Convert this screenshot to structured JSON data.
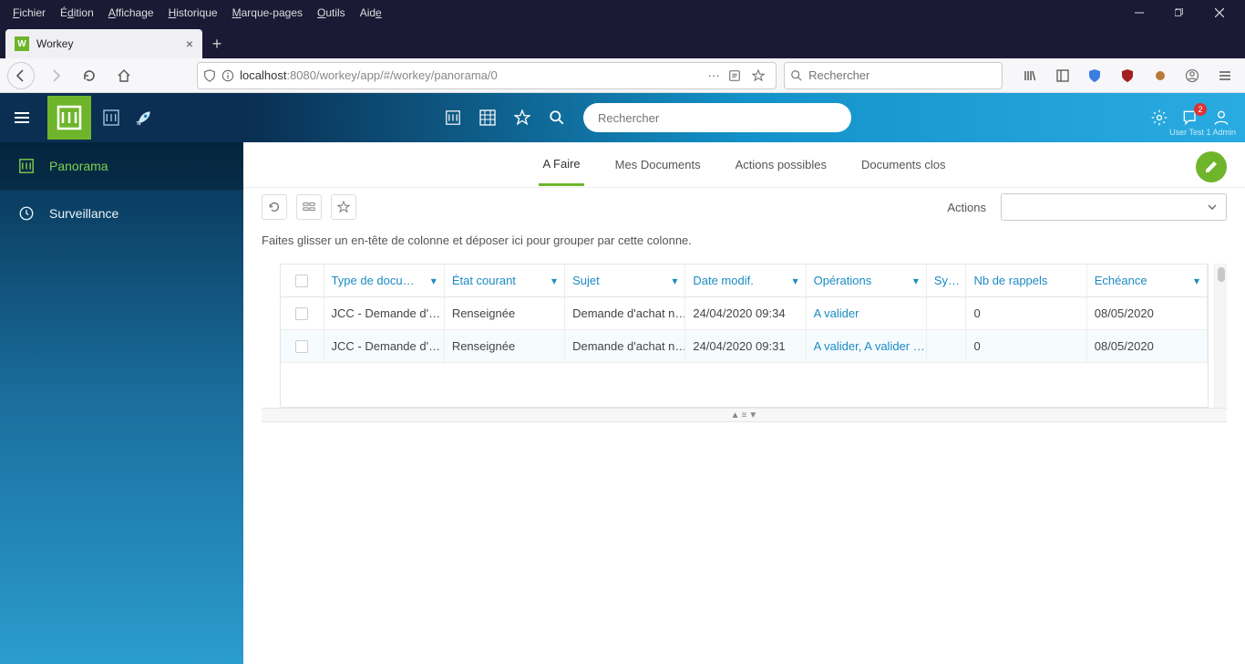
{
  "browser": {
    "menu": [
      "Fichier",
      "Édition",
      "Affichage",
      "Historique",
      "Marque-pages",
      "Outils",
      "Aide"
    ],
    "tab_title": "Workey",
    "url_host": "localhost",
    "url_port": ":8080",
    "url_path": "/workey/app/#/workey/panorama/0",
    "search_placeholder": "Rechercher"
  },
  "app": {
    "search_placeholder": "Rechercher",
    "user_label": "User Test 1 Admin",
    "notification_count": "2"
  },
  "sidebar": {
    "items": [
      {
        "label": "Panorama",
        "active": true
      },
      {
        "label": "Surveillance",
        "active": false
      }
    ]
  },
  "tabs": {
    "items": [
      {
        "label": "A Faire",
        "active": true
      },
      {
        "label": "Mes Documents",
        "active": false
      },
      {
        "label": "Actions possibles",
        "active": false
      },
      {
        "label": "Documents clos",
        "active": false
      }
    ],
    "actions_label": "Actions"
  },
  "grid": {
    "group_hint": "Faites glisser un en-tête de colonne et déposer ici pour grouper par cette colonne.",
    "columns": {
      "type": "Type de docu…",
      "etat": "État courant",
      "sujet": "Sujet",
      "date": "Date modif.",
      "ops": "Opérations",
      "sys": "Sy…",
      "rappels": "Nb de rappels",
      "echeance": "Echéance"
    },
    "rows": [
      {
        "type": "JCC - Demande d'…",
        "etat": "Renseignée",
        "sujet": "Demande d'achat n…",
        "date": "24/04/2020 09:34",
        "ops": "A valider",
        "sys": "",
        "rappels": "0",
        "echeance": "08/05/2020"
      },
      {
        "type": "JCC - Demande d'…",
        "etat": "Renseignée",
        "sujet": "Demande d'achat n…",
        "date": "24/04/2020 09:31",
        "ops": "A valider, A valider …",
        "sys": "",
        "rappels": "0",
        "echeance": "08/05/2020"
      }
    ]
  }
}
